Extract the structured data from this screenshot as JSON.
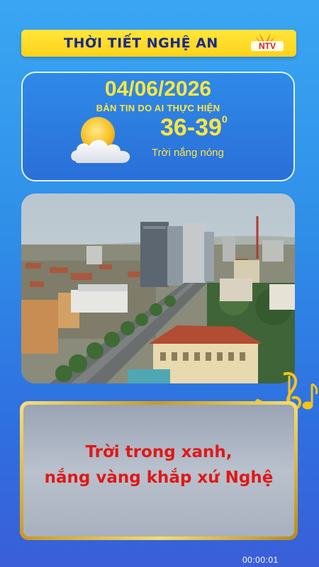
{
  "header": {
    "title": "THỜI TIẾT NGHỆ AN",
    "logo_text": "NTV"
  },
  "weather": {
    "date": "04/06/2026",
    "subtitle": "BẢN TIN DO AI THỰC HIỆN",
    "temperature": "36-39",
    "degree_mark": "0",
    "condition": "Trời nắng nóng",
    "icon": "sun-behind-cloud-icon"
  },
  "message": {
    "line1": "Trời trong xanh,",
    "line2": "nắng vàng khắp xứ Nghệ"
  },
  "timestamp": "00:00:01",
  "colors": {
    "background": "#2f8fe8",
    "title_bar": "#ffd21a",
    "title_text": "#1a2a8a",
    "accent_yellow": "#ffe640",
    "message_text": "#e01818",
    "frame_gold": "#c89a22"
  }
}
